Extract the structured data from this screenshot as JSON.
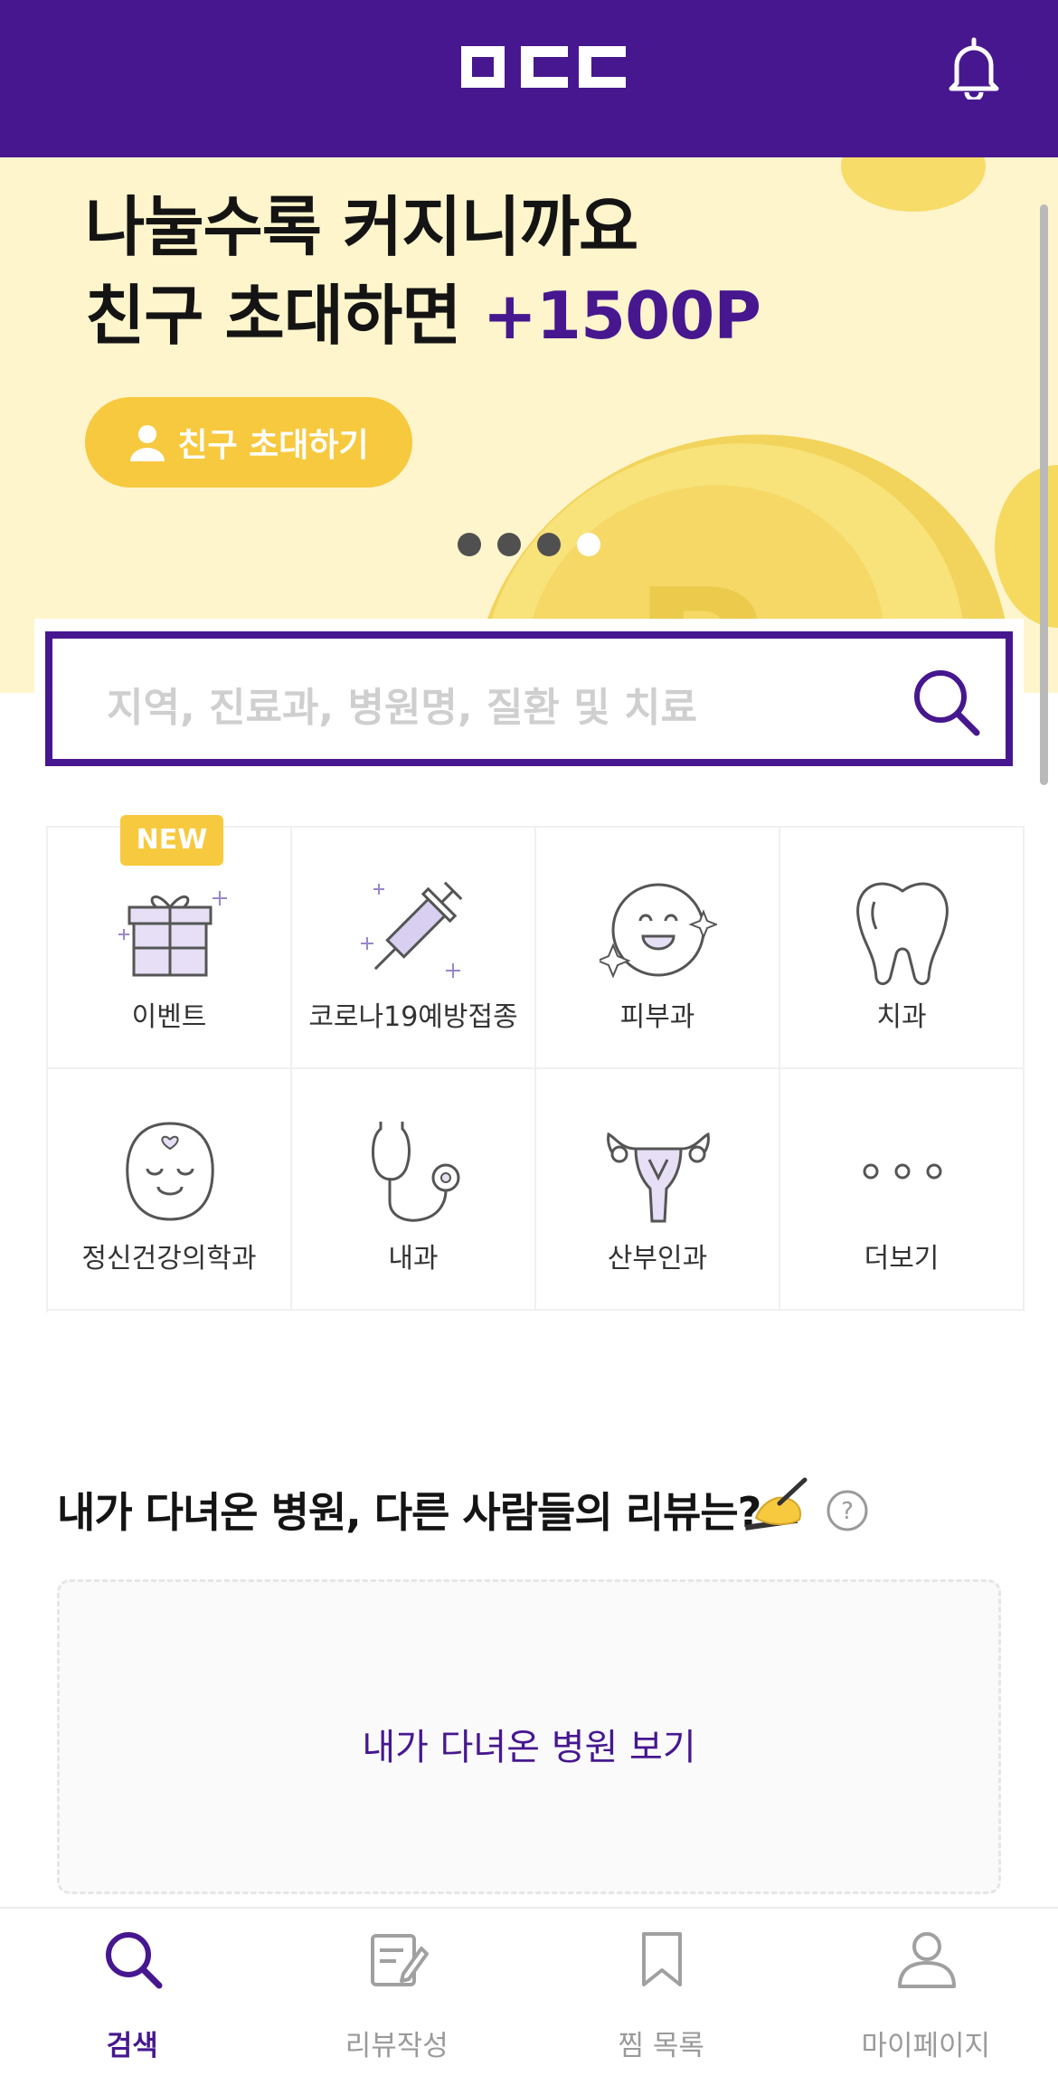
{
  "header": {
    "logo_text": "OCC",
    "notification_icon": "bell-icon"
  },
  "banner": {
    "line1": "나눌수록 커지니까요",
    "line2_prefix": "친구 초대하면 ",
    "line2_accent": "+1500P",
    "invite_button": "친구 초대하기",
    "slide_count": 4,
    "active_slide": 4
  },
  "search": {
    "placeholder": "지역, 진료과, 병원명, 질환 및 치료"
  },
  "categories": [
    {
      "label": "이벤트",
      "icon": "gift-icon",
      "badge": "NEW"
    },
    {
      "label": "코로나19예방접종",
      "icon": "syringe-icon"
    },
    {
      "label": "피부과",
      "icon": "smile-face-icon"
    },
    {
      "label": "치과",
      "icon": "tooth-icon"
    },
    {
      "label": "정신건강의학과",
      "icon": "calm-face-icon"
    },
    {
      "label": "내과",
      "icon": "stethoscope-icon"
    },
    {
      "label": "산부인과",
      "icon": "uterus-icon"
    },
    {
      "label": "더보기",
      "icon": "more-dots-icon"
    }
  ],
  "reviews": {
    "title": "내가 다녀온 병원, 다른 사람들의 리뷰는?",
    "card_link": "내가 다녀온 병원 보기"
  },
  "bottom_nav": [
    {
      "label": "검색",
      "icon": "search-icon",
      "active": true
    },
    {
      "label": "리뷰작성",
      "icon": "write-review-icon",
      "active": false
    },
    {
      "label": "찜 목록",
      "icon": "bookmark-icon",
      "active": false
    },
    {
      "label": "마이페이지",
      "icon": "user-icon",
      "active": false
    }
  ],
  "colors": {
    "brand": "#46178f",
    "accent_yellow": "#f6c93f",
    "banner_bg": "#fff5cc"
  }
}
